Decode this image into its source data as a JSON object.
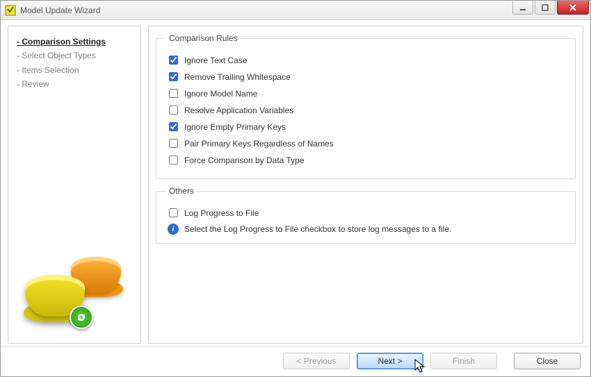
{
  "window": {
    "title": "Model Update Wizard"
  },
  "steps": {
    "items": [
      {
        "label": "Comparison Settings",
        "active": true
      },
      {
        "label": "Select Object Types",
        "active": false
      },
      {
        "label": "Items Selection",
        "active": false
      },
      {
        "label": "Review",
        "active": false
      }
    ]
  },
  "groups": {
    "rules_legend": "Comparison Rules",
    "others_legend": "Others"
  },
  "rules": [
    {
      "label": "Ignore Text Case",
      "checked": true
    },
    {
      "label": "Remove Trailing Whitespace",
      "checked": true
    },
    {
      "label": "Ignore Model Name",
      "checked": false
    },
    {
      "label": "Resolve Application Variables",
      "checked": false
    },
    {
      "label": "Ignore Empty Primary Keys",
      "checked": true
    },
    {
      "label": "Pair Primary Keys Regardless of Names",
      "checked": false
    },
    {
      "label": "Force Comparison by Data Type",
      "checked": false
    }
  ],
  "others": {
    "log_label": "Log Progress to File",
    "log_checked": false,
    "info_text": "Select the Log Progress to File checkbox to store log messages to a file."
  },
  "buttons": {
    "previous": "< Previous",
    "next": "Next >",
    "finish": "Finish",
    "close": "Close"
  }
}
